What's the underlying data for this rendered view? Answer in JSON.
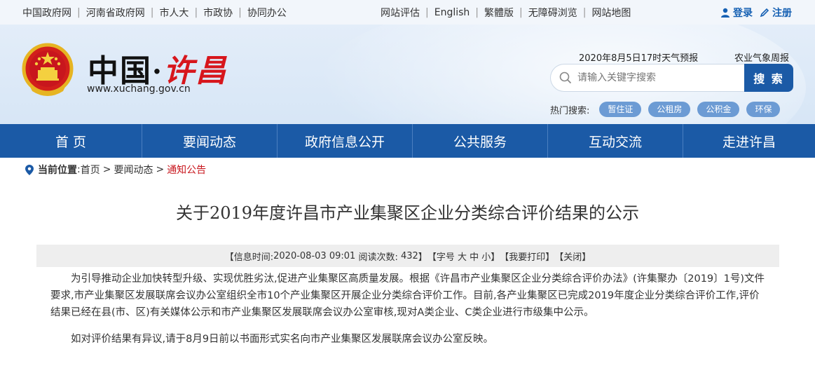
{
  "topbar": {
    "left_links": [
      "中国政府网",
      "河南省政府网",
      "市人大",
      "市政协",
      "协同办公"
    ],
    "right_links": [
      "网站评估",
      "English",
      "繁體版",
      "无障碍浏览",
      "网站地图"
    ],
    "login_label": "登录",
    "register_label": "注册"
  },
  "header": {
    "brand_main": "中国",
    "brand_dot": "·",
    "brand_city": "许昌",
    "domain": "www.xuchang.gov.cn",
    "weather": "2020年8月5日17时天气预报",
    "agri_weather": "农业气象周报",
    "search": {
      "placeholder": "请输入关键字搜索",
      "button": "搜 索"
    },
    "hot_search": {
      "label": "热门搜索:",
      "tags": [
        "暂住证",
        "公租房",
        "公积金",
        "环保"
      ]
    }
  },
  "nav": {
    "items": [
      "首 页",
      "要闻动态",
      "政府信息公开",
      "公共服务",
      "互动交流",
      "走进许昌"
    ]
  },
  "breadcrumb": {
    "label": "当前位置",
    "colon": ":",
    "items": [
      "首页",
      "要闻动态",
      "通知公告"
    ]
  },
  "article": {
    "title": "关于2019年度许昌市产业集聚区企业分类综合评价结果的公示",
    "meta": {
      "info_prefix": "【信息时间:",
      "date": "2020-08-03 09:01",
      "reads_label": "阅读次数:",
      "reads": "432",
      "info_suffix": "】",
      "font_size_label": "【字号 大 中 小】",
      "print_label": "【我要打印】",
      "close_label": "【关闭】"
    },
    "paragraphs": [
      "为引导推动企业加快转型升级、实现优胜劣汰,促进产业集聚区高质量发展。根据《许昌市产业集聚区企业分类综合评价办法》(许集聚办〔2019〕1号)文件要求,市产业集聚区发展联席会议办公室组织全市10个产业集聚区开展企业分类综合评价工作。目前,各产业集聚区已完成2019年度企业分类综合评价工作,评价结果已经在县(市、区)有关媒体公示和市产业集聚区发展联席会议办公室审核,现对A类企业、C类企业进行市级集中公示。",
      "如对评价结果有异议,请于8月9日前以书面形式实名向市产业集聚区发展联席会议办公室反映。"
    ]
  },
  "colors": {
    "nav_blue": "#1b5aa6",
    "accent_red": "#c8161d",
    "tag_blue": "#6c9bd4"
  }
}
